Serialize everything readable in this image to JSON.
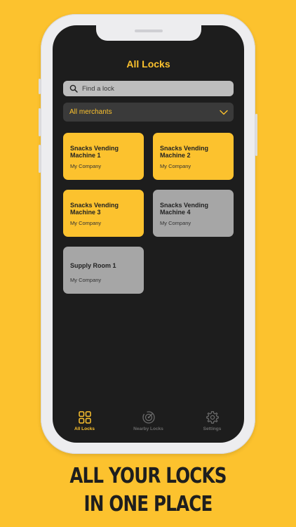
{
  "screen": {
    "title": "All Locks",
    "search": {
      "placeholder": "Find a lock",
      "value": ""
    },
    "merchant_filter": {
      "selected": "All merchants"
    }
  },
  "locks": [
    {
      "name": "Snacks Vending Machine 1",
      "company": "My Company",
      "state": "active"
    },
    {
      "name": "Snacks Vending Machine 2",
      "company": "My Company",
      "state": "active"
    },
    {
      "name": "Snacks Vending Machine 3",
      "company": "My Company",
      "state": "active"
    },
    {
      "name": "Snacks Vending Machine 4",
      "company": "My Company",
      "state": "inactive"
    },
    {
      "name": "Supply Room 1",
      "company": "My Company",
      "state": "inactive"
    }
  ],
  "tabbar": {
    "items": [
      {
        "label": "All Locks",
        "icon": "grid-icon",
        "active": true
      },
      {
        "label": "Nearby Locks",
        "icon": "radar-icon",
        "active": false
      },
      {
        "label": "Settings",
        "icon": "gear-icon",
        "active": false
      }
    ]
  },
  "promo": {
    "line1": "ALL YOUR LOCKS",
    "line2": "IN ONE PLACE"
  },
  "colors": {
    "accent": "#FCC22E",
    "screen_bg": "#1D1D1D",
    "inactive_card": "#A6A6A6"
  }
}
